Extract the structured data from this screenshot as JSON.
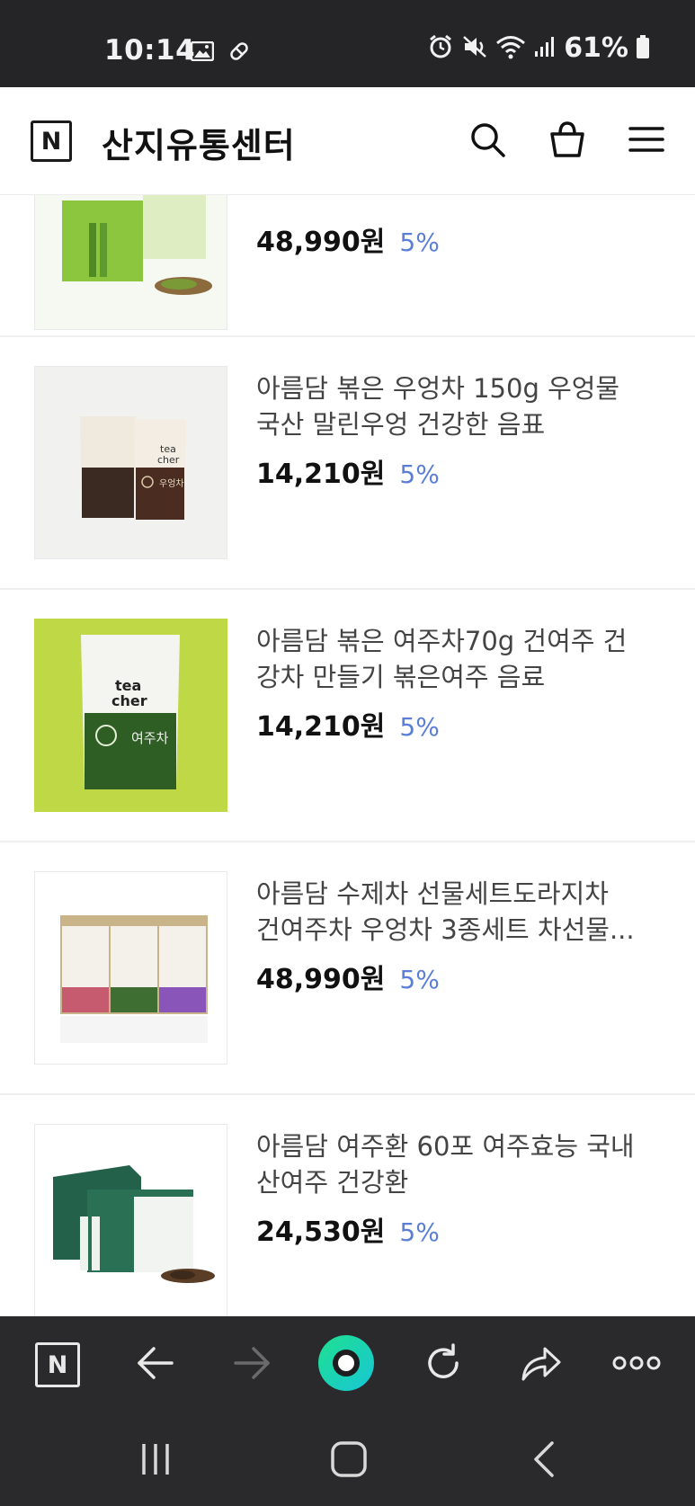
{
  "status_bar": {
    "time": "10:14",
    "battery": "61%",
    "icons": [
      "image-icon",
      "paperclip-icon",
      "alarm-icon",
      "mute-icon",
      "wifi-icon",
      "signal-icon",
      "battery-icon"
    ]
  },
  "header": {
    "logo_letter": "N",
    "title": "산지유통센터",
    "icons": [
      "search-icon",
      "cart-icon",
      "menu-icon"
    ]
  },
  "products": [
    {
      "name_lines": [],
      "price": "48,990원",
      "discount": "5%",
      "thumb": "green-gift-box-with-powder"
    },
    {
      "name_lines": [
        "아름담 볶은 우엉차 150g 우엉물",
        "국산 말린우엉 건강한 음표"
      ],
      "price": "14,210원",
      "discount": "5%",
      "thumb": "burdock-tea-pouches"
    },
    {
      "name_lines": [
        "아름담 볶은 여주차70g 건여주 건",
        "강차 만들기 볶은여주 음료"
      ],
      "price": "14,210원",
      "discount": "5%",
      "thumb": "bitter-melon-tea-pouch"
    },
    {
      "name_lines": [
        "아름담 수제차 선물세트도라지차",
        "건여주차 우엉차 3종세트 차선물..."
      ],
      "price": "48,990원",
      "discount": "5%",
      "thumb": "three-tea-gift-set"
    },
    {
      "name_lines": [
        "아름담 여주환 60포 여주효능 국내",
        "산여주 건강환"
      ],
      "price": "24,530원",
      "discount": "5%",
      "thumb": "green-box-pills"
    }
  ],
  "pouch_text": {
    "brand_top": "tea",
    "brand_bottom": "cher",
    "burdock_label": "우엉차",
    "melon_label": "여주차"
  },
  "browser_bar": {
    "home_letter": "N",
    "icons": [
      "naver-home-icon",
      "back-arrow-icon",
      "forward-arrow-icon",
      "green-dot-icon",
      "refresh-icon",
      "share-icon",
      "more-icon"
    ]
  },
  "nav_bar": {
    "icons": [
      "recent-apps-icon",
      "home-icon",
      "back-icon"
    ]
  },
  "colors": {
    "status_bar_bg": "#252527",
    "discount": "#5b7fd6",
    "accent_green": "#1fd3a0",
    "lime_bg": "#bfd845"
  }
}
